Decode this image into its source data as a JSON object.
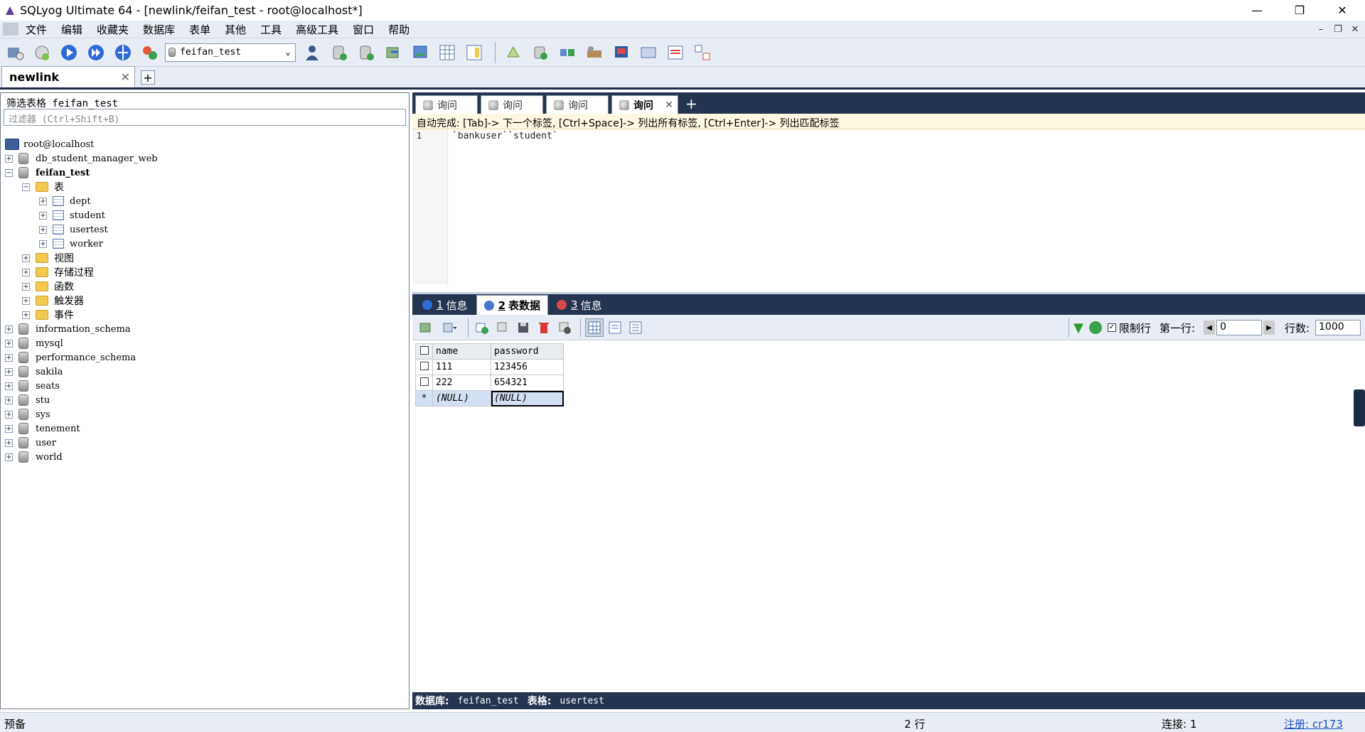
{
  "window": {
    "title": "SQLyog Ultimate 64 - [newlink/feifan_test - root@localhost*]",
    "minimize": "—",
    "restore": "❐",
    "close": "✕"
  },
  "menu": [
    "文件",
    "编辑",
    "收藏夹",
    "数据库",
    "表单",
    "其他",
    "工具",
    "高级工具",
    "窗口",
    "帮助"
  ],
  "mdi": {
    "min": "–",
    "restore": "❐",
    "close": "✕"
  },
  "toolbar": {
    "database_selected": "feifan_test"
  },
  "connection_tab": {
    "label": "newlink",
    "close": "✕",
    "add": "+"
  },
  "left": {
    "filter_header": "筛选表格 feifan_test",
    "filter_placeholder": "过滤器 (Ctrl+Shift+B)",
    "server": "root@localhost",
    "tree": [
      {
        "label": "db_student_manager_web",
        "type": "db",
        "level": 1,
        "expander": "+"
      },
      {
        "label": "feifan_test",
        "type": "db",
        "level": 1,
        "expander": "−",
        "bold": true
      },
      {
        "label": "表",
        "type": "folder",
        "level": 2,
        "expander": "−"
      },
      {
        "label": "dept",
        "type": "table",
        "level": 3,
        "expander": "+"
      },
      {
        "label": "student",
        "type": "table",
        "level": 3,
        "expander": "+"
      },
      {
        "label": "usertest",
        "type": "table",
        "level": 3,
        "expander": "+"
      },
      {
        "label": "worker",
        "type": "table",
        "level": 3,
        "expander": "+"
      },
      {
        "label": "视图",
        "type": "folder",
        "level": 2,
        "expander": "+"
      },
      {
        "label": "存储过程",
        "type": "folder",
        "level": 2,
        "expander": "+"
      },
      {
        "label": "函数",
        "type": "folder",
        "level": 2,
        "expander": "+"
      },
      {
        "label": "触发器",
        "type": "folder",
        "level": 2,
        "expander": "+"
      },
      {
        "label": "事件",
        "type": "folder",
        "level": 2,
        "expander": "+"
      },
      {
        "label": "information_schema",
        "type": "db",
        "level": 1,
        "expander": "+"
      },
      {
        "label": "mysql",
        "type": "db",
        "level": 1,
        "expander": "+"
      },
      {
        "label": "performance_schema",
        "type": "db",
        "level": 1,
        "expander": "+"
      },
      {
        "label": "sakila",
        "type": "db",
        "level": 1,
        "expander": "+"
      },
      {
        "label": "seats",
        "type": "db",
        "level": 1,
        "expander": "+"
      },
      {
        "label": "stu",
        "type": "db",
        "level": 1,
        "expander": "+"
      },
      {
        "label": "sys",
        "type": "db",
        "level": 1,
        "expander": "+"
      },
      {
        "label": "tenement",
        "type": "db",
        "level": 1,
        "expander": "+"
      },
      {
        "label": "user",
        "type": "db",
        "level": 1,
        "expander": "+"
      },
      {
        "label": "world",
        "type": "db",
        "level": 1,
        "expander": "+"
      }
    ]
  },
  "query_tabs": [
    {
      "label": "询问",
      "active": false
    },
    {
      "label": "询问",
      "active": false
    },
    {
      "label": "询问",
      "active": false
    },
    {
      "label": "询问",
      "active": true
    }
  ],
  "query_tab_close": "✕",
  "query_tab_add": "+",
  "autocomplete_hint": "自动完成: [Tab]-> 下一个标签, [Ctrl+Space]-> 列出所有标签, [Ctrl+Enter]-> 列出匹配标签",
  "editor": {
    "line_number": "1",
    "code": "`bankuser``student`"
  },
  "result_tabs": [
    {
      "num": "1",
      "label": "信息",
      "active": false,
      "icon_color": "#2f6bd8"
    },
    {
      "num": "2",
      "label": "表数据",
      "active": true,
      "icon_color": "#4a78c8"
    },
    {
      "num": "3",
      "label": "信息",
      "active": false,
      "icon_color": "#d84a4a"
    }
  ],
  "result_toolbar": {
    "limit_label": "限制行",
    "first_row_label": "第一行:",
    "first_row_value": "0",
    "rows_label": "行数:",
    "rows_value": "1000"
  },
  "grid": {
    "columns": [
      "name",
      "password"
    ],
    "rows": [
      [
        "111",
        "123456"
      ],
      [
        "222",
        "654321"
      ]
    ],
    "new_row": [
      "(NULL)",
      "(NULL)"
    ],
    "new_row_marker": "*"
  },
  "info_bar": {
    "db_label": "数据库:",
    "db_value": "feifan_test",
    "table_label": "表格:",
    "table_value": "usertest"
  },
  "statusbar": {
    "left": "预备",
    "rows": "2 行",
    "connection": "连接: 1",
    "register": "注册: cr173"
  }
}
